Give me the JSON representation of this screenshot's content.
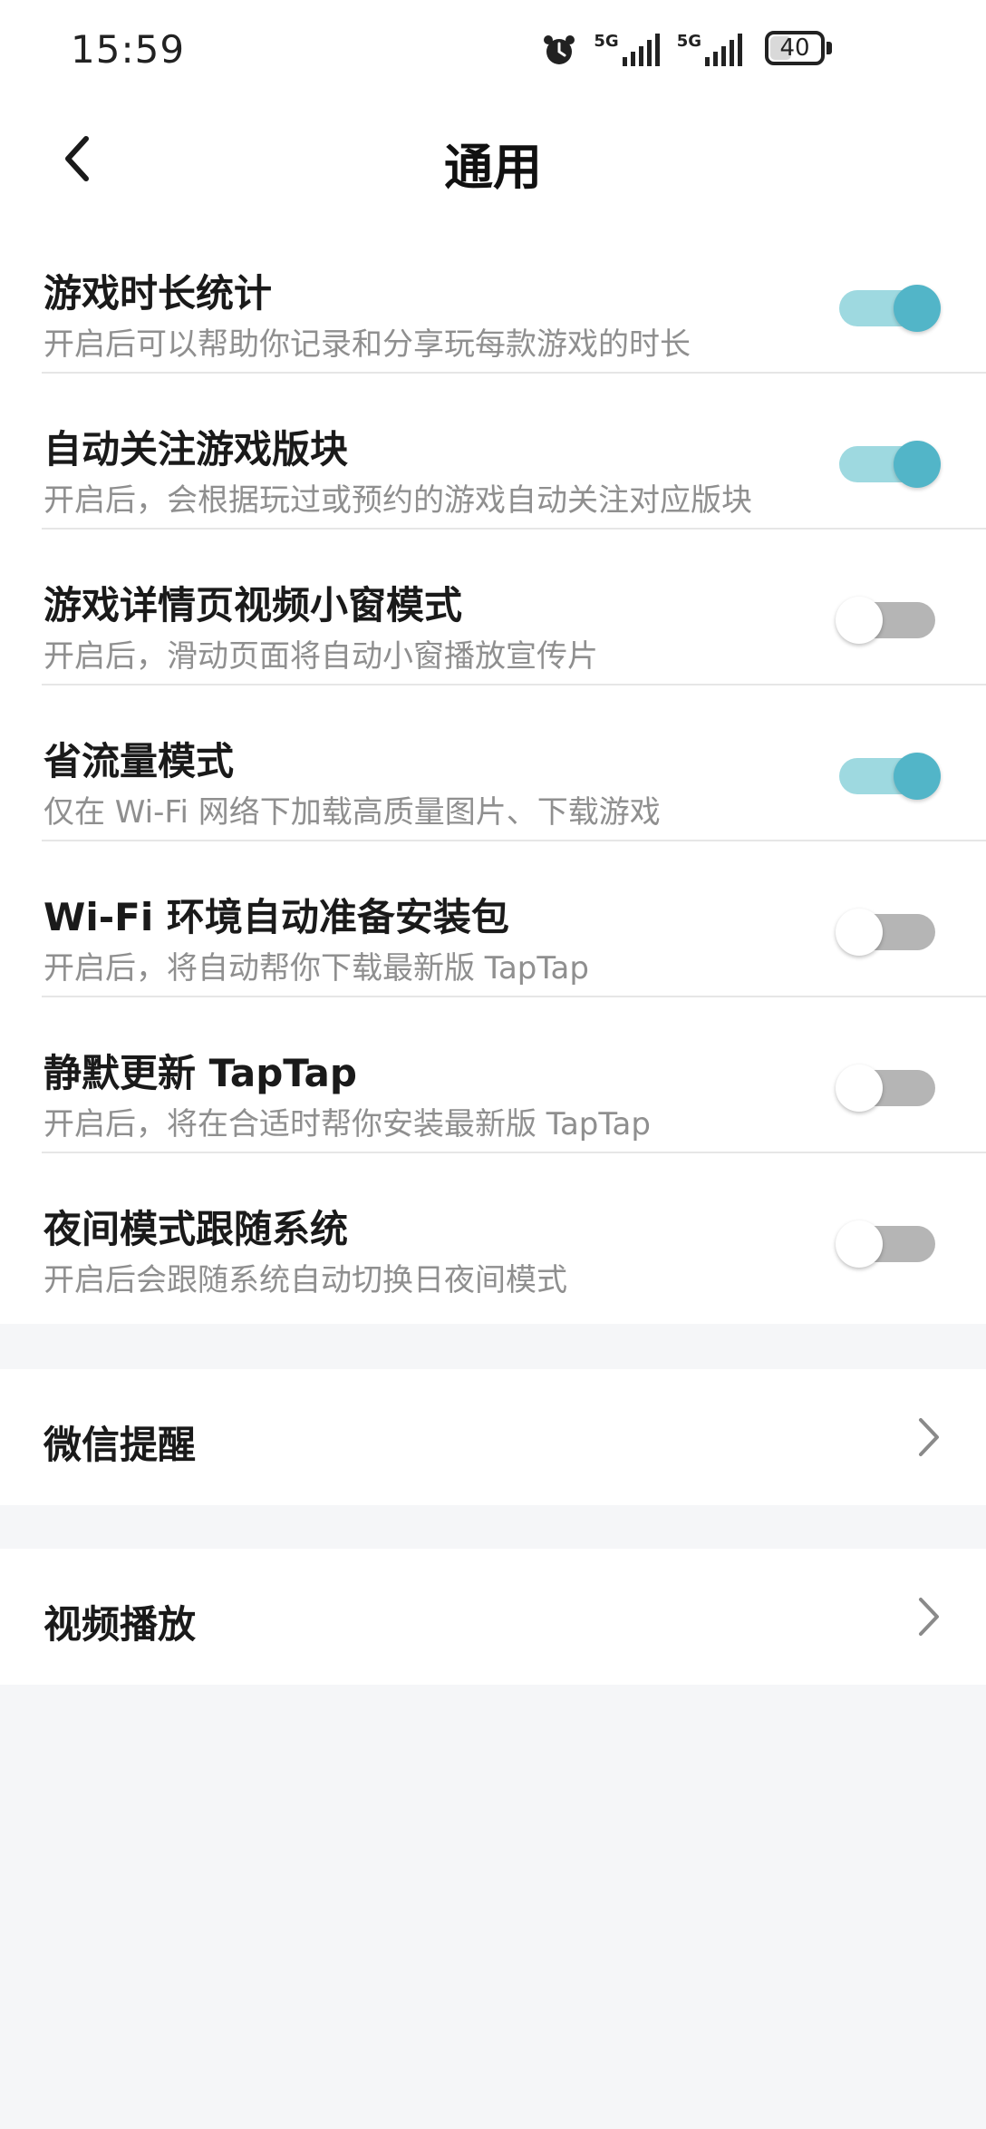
{
  "status_bar": {
    "time": "15:59",
    "network_1": "5G",
    "network_2": "5G",
    "battery": "40",
    "icons": [
      "alarm-icon",
      "signal-icon",
      "signal-icon",
      "battery-icon"
    ]
  },
  "header": {
    "title": "通用",
    "back_icon": "chevron-left-icon"
  },
  "settings": [
    {
      "title": "游戏时长统计",
      "desc": "开启后可以帮助你记录和分享玩每款游戏的时长",
      "enabled": true
    },
    {
      "title": "自动关注游戏版块",
      "desc": "开启后，会根据玩过或预约的游戏自动关注对应版块",
      "enabled": true
    },
    {
      "title": "游戏详情页视频小窗模式",
      "desc": "开启后，滑动页面将自动小窗播放宣传片",
      "enabled": false
    },
    {
      "title": "省流量模式",
      "desc": "仅在 Wi-Fi 网络下加载高质量图片、下载游戏",
      "enabled": true
    },
    {
      "title": "Wi-Fi 环境自动准备安装包",
      "desc": "开启后，将自动帮你下载最新版 TapTap",
      "enabled": false
    },
    {
      "title": "静默更新 TapTap",
      "desc": "开启后，将在合适时帮你安装最新版 TapTap",
      "enabled": false
    },
    {
      "title": "夜间模式跟随系统",
      "desc": "开启后会跟随系统自动切换日夜间模式",
      "enabled": false
    }
  ],
  "nav_items": [
    {
      "label": "微信提醒",
      "icon": "chevron-right-icon"
    },
    {
      "label": "视频播放",
      "icon": "chevron-right-icon"
    }
  ],
  "colors": {
    "toggle_on_track": "#9ed9e0",
    "toggle_on_knob": "#52b5c8",
    "toggle_off_track": "#b5b5b5",
    "background": "#f5f6f8"
  }
}
